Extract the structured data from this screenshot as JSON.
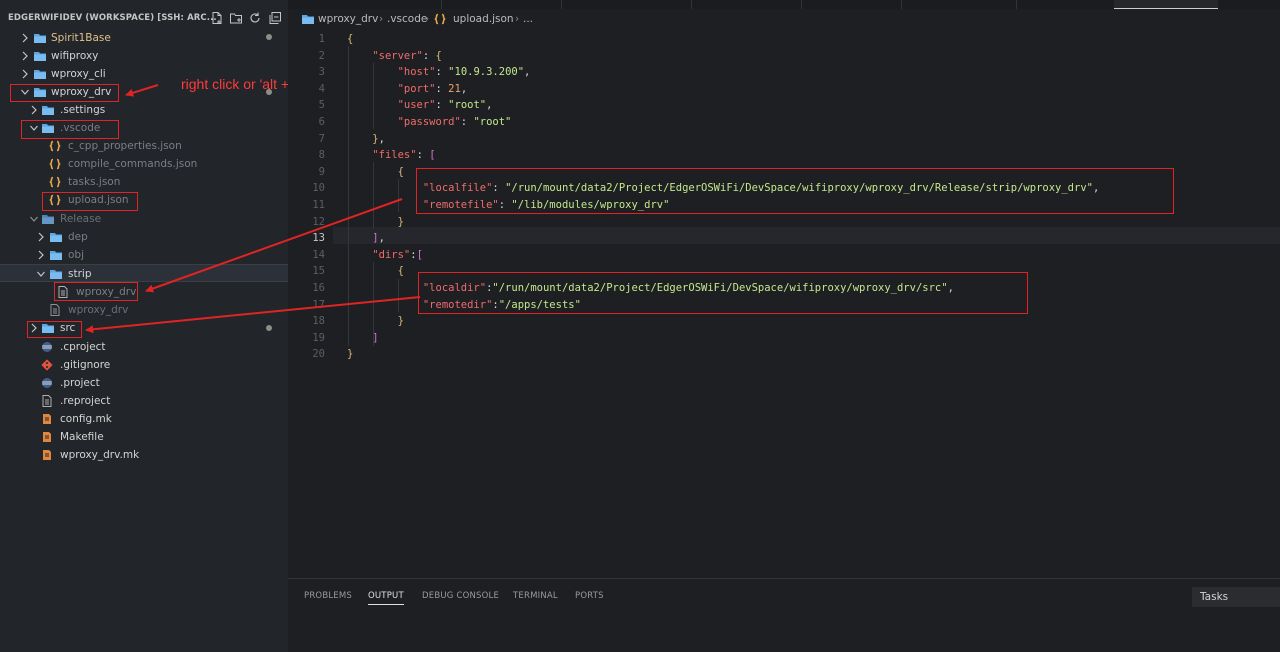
{
  "sidebar": {
    "workspace_title": "EDGERWIFIDEV (WORKSPACE) [SSH: ARC...",
    "actions": [
      "new-file-icon",
      "new-folder-icon",
      "refresh-icon",
      "collapse-all-icon"
    ],
    "tree": [
      {
        "label": "Spirit1Base",
        "kind": "folder",
        "expanded": false
      },
      {
        "label": "wifiproxy",
        "kind": "folder",
        "expanded": false
      },
      {
        "label": "wproxy_cli",
        "kind": "folder",
        "expanded": false
      },
      {
        "label": "wproxy_drv",
        "kind": "folder",
        "expanded": true
      },
      {
        "label": ".settings",
        "kind": "folder",
        "expanded": false
      },
      {
        "label": ".vscode",
        "kind": "folder",
        "expanded": true
      },
      {
        "label": "c_cpp_properties.json",
        "kind": "json"
      },
      {
        "label": "compile_commands.json",
        "kind": "json"
      },
      {
        "label": "tasks.json",
        "kind": "json"
      },
      {
        "label": "upload.json",
        "kind": "json"
      },
      {
        "label": "Release",
        "kind": "folder",
        "expanded": true
      },
      {
        "label": "dep",
        "kind": "folder",
        "expanded": false
      },
      {
        "label": "obj",
        "kind": "folder",
        "expanded": false
      },
      {
        "label": "strip",
        "kind": "folder",
        "expanded": true
      },
      {
        "label": "wproxy_drv",
        "kind": "file"
      },
      {
        "label": "wproxy_drv",
        "kind": "file"
      },
      {
        "label": "src",
        "kind": "folder",
        "expanded": false
      },
      {
        "label": ".cproject",
        "kind": "eclipse"
      },
      {
        "label": ".gitignore",
        "kind": "git"
      },
      {
        "label": ".project",
        "kind": "eclipse"
      },
      {
        "label": ".reproject",
        "kind": "file"
      },
      {
        "label": "config.mk",
        "kind": "make"
      },
      {
        "label": "Makefile",
        "kind": "make"
      },
      {
        "label": "wproxy_drv.mk",
        "kind": "make"
      }
    ]
  },
  "annotation": {
    "text": "right click or 'alt + d'",
    "color": "#ff3b3b"
  },
  "breadcrumb": {
    "items": [
      "wproxy_drv",
      ".vscode",
      "upload.json",
      "..."
    ]
  },
  "editor": {
    "current_line": 13,
    "lines": [
      "{",
      "    \"server\": {",
      "        \"host\": \"10.9.3.200\",",
      "        \"port\": 21,",
      "        \"user\": \"root\",",
      "        \"password\": \"root\"",
      "    },",
      "    \"files\": [",
      "        {",
      "            \"localfile\": \"/run/mount/data2/Project/EdgerOSWiFi/DevSpace/wifiproxy/wproxy_drv/Release/strip/wproxy_drv\",",
      "            \"remotefile\": \"/lib/modules/wproxy_drv\"",
      "        }",
      "    ],",
      "    \"dirs\":[",
      "        {",
      "            \"localdir\":\"/run/mount/data2/Project/EdgerOSWiFi/DevSpace/wifiproxy/wproxy_drv/src\",",
      "            \"remotedir\":\"/apps/tests\"",
      "        }",
      "    ]",
      "}"
    ]
  },
  "panel": {
    "tabs": [
      "PROBLEMS",
      "OUTPUT",
      "DEBUG CONSOLE",
      "TERMINAL",
      "PORTS"
    ],
    "active_tab": "OUTPUT",
    "select_value": "Tasks"
  }
}
